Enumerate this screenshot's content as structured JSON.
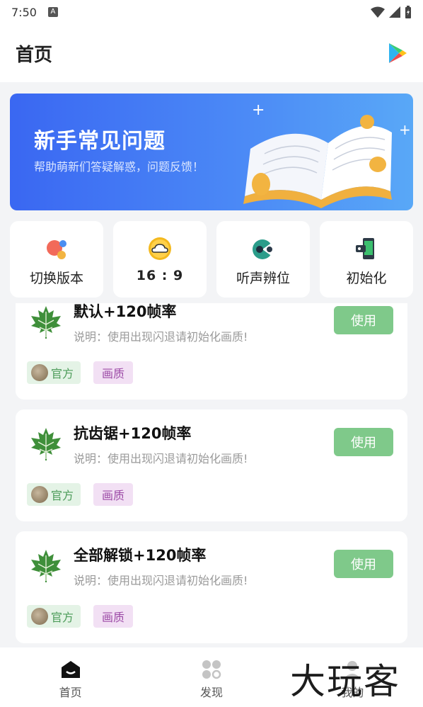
{
  "status_bar": {
    "time": "7:50",
    "badge": "A"
  },
  "app_bar": {
    "title": "首页",
    "icon": "play-store-icon"
  },
  "banner": {
    "title": "新手常见问题",
    "subtitle": "帮助萌新们答疑解惑，问题反馈！"
  },
  "quick_actions": [
    {
      "label": "切换版本",
      "icon": "switch-version-icon"
    },
    {
      "label": "16 : 9",
      "icon": "cloud-icon"
    },
    {
      "label": "听声辨位",
      "icon": "sound-icon"
    },
    {
      "label": "初始化",
      "icon": "phone-reset-icon"
    }
  ],
  "items": [
    {
      "name": "默认+120帧率",
      "desc": "说明：使用出现闪退请初始化画质!",
      "button": "使用",
      "tag_official": "官方",
      "tag_category": "画质"
    },
    {
      "name": "抗齿锯+120帧率",
      "desc": "说明：使用出现闪退请初始化画质!",
      "button": "使用",
      "tag_official": "官方",
      "tag_category": "画质"
    },
    {
      "name": "全部解锁+120帧率",
      "desc": "说明：使用出现闪退请初始化画质!",
      "button": "使用",
      "tag_official": "官方",
      "tag_category": "画质"
    }
  ],
  "bottom_nav": [
    {
      "label": "首页",
      "icon": "home-icon",
      "active": true
    },
    {
      "label": "发现",
      "icon": "grid-icon",
      "active": false
    },
    {
      "label": "我的",
      "icon": "user-icon",
      "active": false
    }
  ],
  "watermark": "大玩客",
  "colors": {
    "accent": "#7fc98a",
    "banner_start": "#3a67f2",
    "banner_end": "#59a8f7",
    "tag_official_bg": "#e4f3e6",
    "tag_category_bg": "#f2e0f4"
  }
}
